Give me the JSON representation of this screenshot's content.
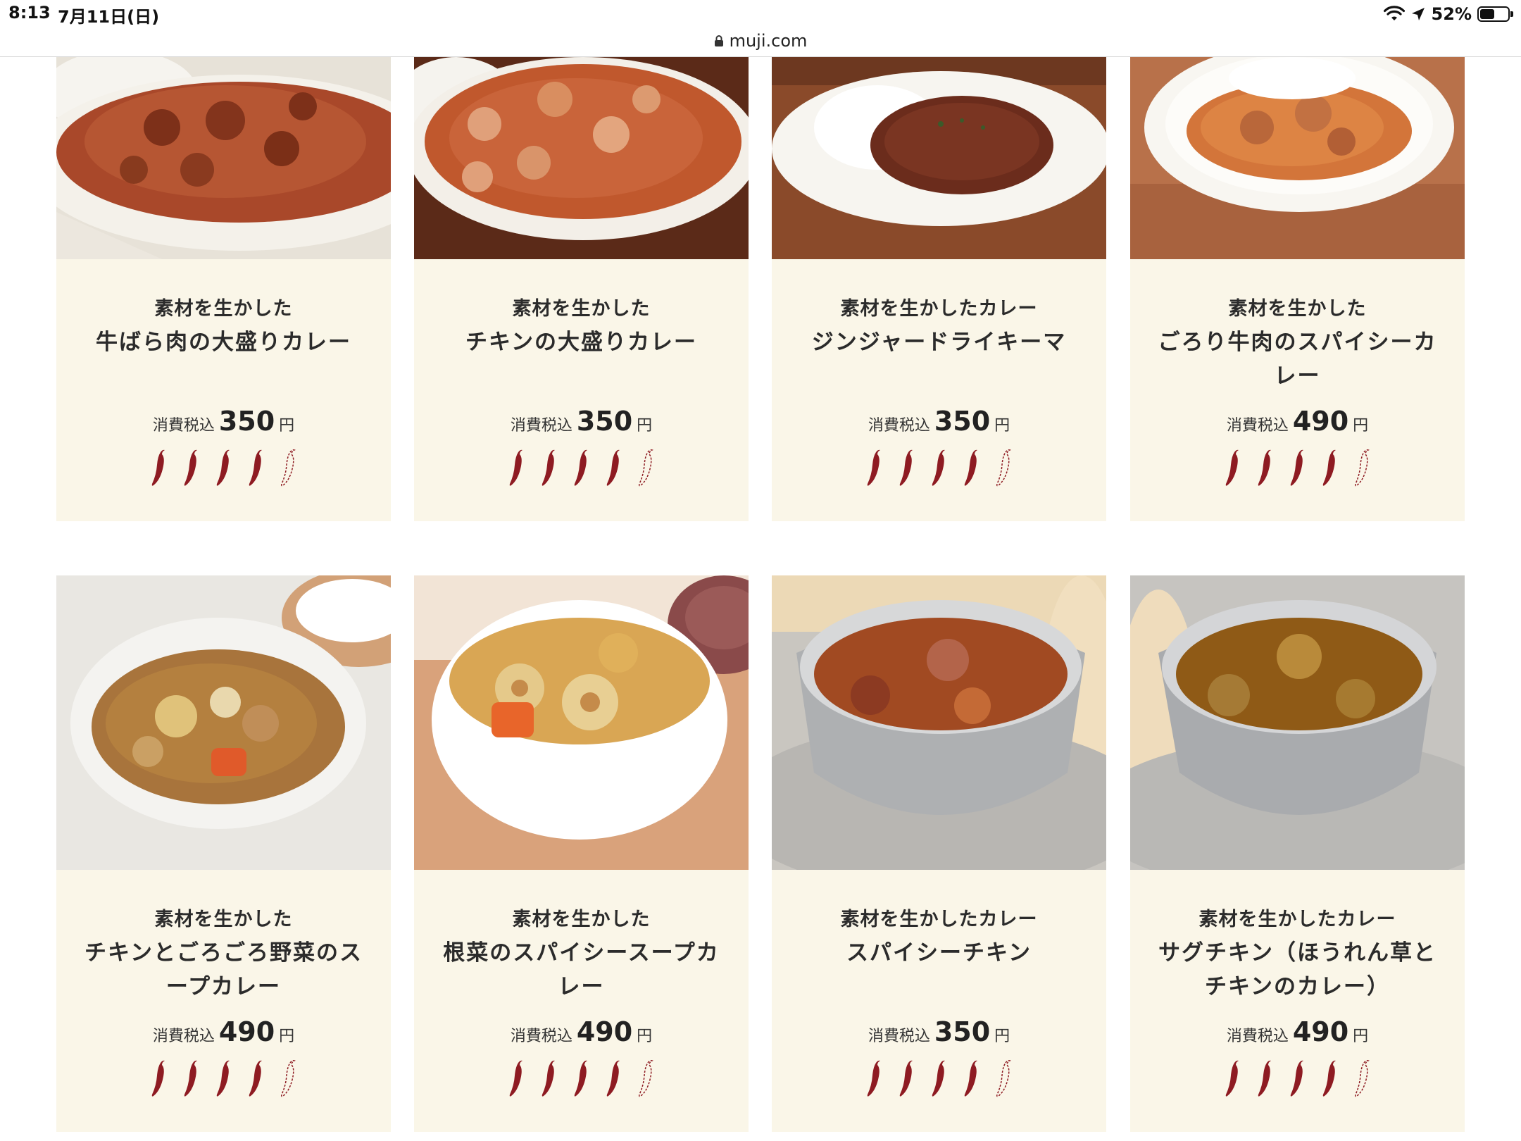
{
  "status_bar": {
    "time": "8:13",
    "date": "7月11日(日)",
    "battery_percent": "52%",
    "battery_level": 0.52
  },
  "address_bar": {
    "url": "muji.com"
  },
  "colors": {
    "card_background": "#faf6e8",
    "chili_filled": "#8e1b22",
    "chili_outline": "#8e1b22"
  },
  "products": [
    {
      "subtitle": "素材を生かした",
      "name": "牛ばら肉の大盛りカレー",
      "price_label": "消費税込",
      "price": "350",
      "price_unit": "円",
      "spice_level": 4,
      "spice_max": 5,
      "image": "beef-curry-photo"
    },
    {
      "subtitle": "素材を生かした",
      "name": "チキンの大盛りカレー",
      "price_label": "消費税込",
      "price": "350",
      "price_unit": "円",
      "spice_level": 4,
      "spice_max": 5,
      "image": "chicken-curry-photo"
    },
    {
      "subtitle": "素材を生かしたカレー",
      "name": "ジンジャードライキーマ",
      "price_label": "消費税込",
      "price": "350",
      "price_unit": "円",
      "spice_level": 4,
      "spice_max": 5,
      "image": "dry-keema-photo"
    },
    {
      "subtitle": "素材を生かした",
      "name": "ごろり牛肉のスパイシーカレー",
      "price_label": "消費税込",
      "price": "490",
      "price_unit": "円",
      "spice_level": 4,
      "spice_max": 5,
      "image": "spicy-beef-curry-photo"
    },
    {
      "subtitle": "素材を生かした",
      "name": "チキンとごろごろ野菜のスープカレー",
      "price_label": "消費税込",
      "price": "490",
      "price_unit": "円",
      "spice_level": 4,
      "spice_max": 5,
      "image": "vegetable-soup-curry-photo"
    },
    {
      "subtitle": "素材を生かした",
      "name": "根菜のスパイシースープカレー",
      "price_label": "消費税込",
      "price": "490",
      "price_unit": "円",
      "spice_level": 4,
      "spice_max": 5,
      "image": "root-vegetable-soup-curry-photo"
    },
    {
      "subtitle": "素材を生かしたカレー",
      "name": "スパイシーチキン",
      "price_label": "消費税込",
      "price": "350",
      "price_unit": "円",
      "spice_level": 4,
      "spice_max": 5,
      "image": "spicy-chicken-photo"
    },
    {
      "subtitle": "素材を生かしたカレー",
      "name": "サグチキン（ほうれん草とチキンのカレー）",
      "price_label": "消費税込",
      "price": "490",
      "price_unit": "円",
      "spice_level": 4,
      "spice_max": 5,
      "image": "saag-chicken-photo"
    }
  ]
}
